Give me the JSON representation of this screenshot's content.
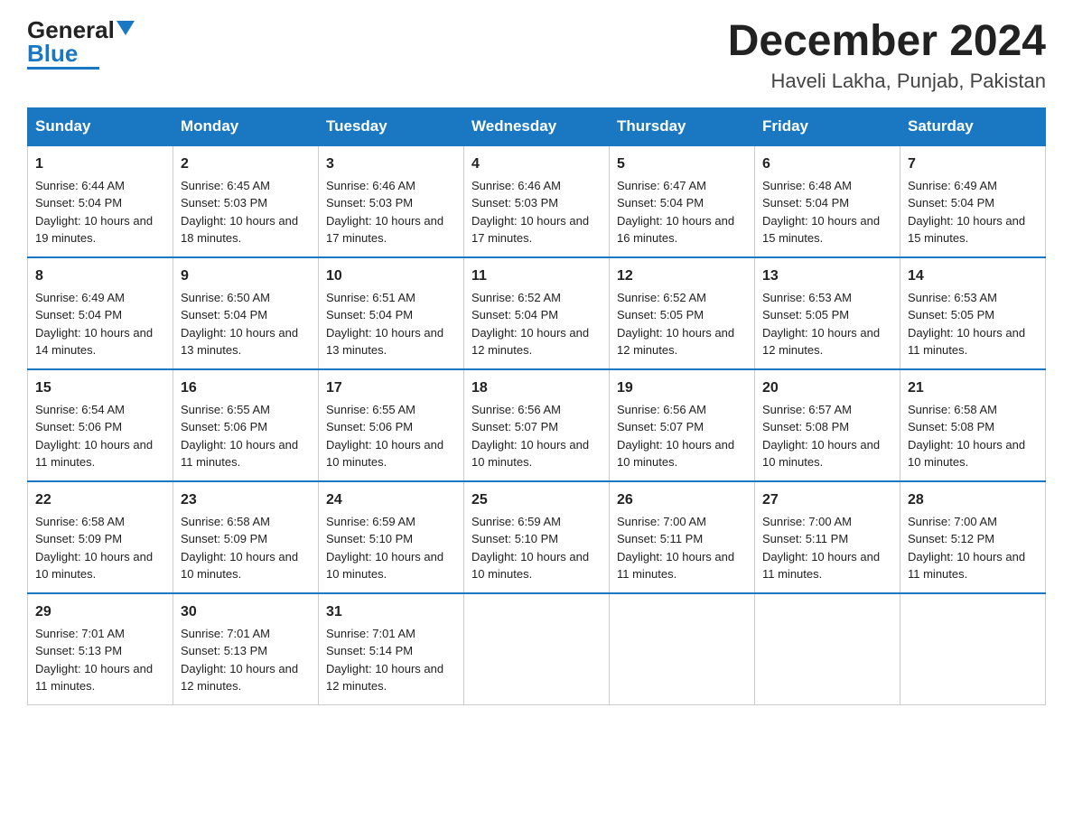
{
  "logo": {
    "general": "General",
    "blue": "Blue"
  },
  "title": "December 2024",
  "location": "Haveli Lakha, Punjab, Pakistan",
  "weekdays": [
    "Sunday",
    "Monday",
    "Tuesday",
    "Wednesday",
    "Thursday",
    "Friday",
    "Saturday"
  ],
  "weeks": [
    [
      {
        "day": "1",
        "sunrise": "6:44 AM",
        "sunset": "5:04 PM",
        "daylight": "10 hours and 19 minutes."
      },
      {
        "day": "2",
        "sunrise": "6:45 AM",
        "sunset": "5:03 PM",
        "daylight": "10 hours and 18 minutes."
      },
      {
        "day": "3",
        "sunrise": "6:46 AM",
        "sunset": "5:03 PM",
        "daylight": "10 hours and 17 minutes."
      },
      {
        "day": "4",
        "sunrise": "6:46 AM",
        "sunset": "5:03 PM",
        "daylight": "10 hours and 17 minutes."
      },
      {
        "day": "5",
        "sunrise": "6:47 AM",
        "sunset": "5:04 PM",
        "daylight": "10 hours and 16 minutes."
      },
      {
        "day": "6",
        "sunrise": "6:48 AM",
        "sunset": "5:04 PM",
        "daylight": "10 hours and 15 minutes."
      },
      {
        "day": "7",
        "sunrise": "6:49 AM",
        "sunset": "5:04 PM",
        "daylight": "10 hours and 15 minutes."
      }
    ],
    [
      {
        "day": "8",
        "sunrise": "6:49 AM",
        "sunset": "5:04 PM",
        "daylight": "10 hours and 14 minutes."
      },
      {
        "day": "9",
        "sunrise": "6:50 AM",
        "sunset": "5:04 PM",
        "daylight": "10 hours and 13 minutes."
      },
      {
        "day": "10",
        "sunrise": "6:51 AM",
        "sunset": "5:04 PM",
        "daylight": "10 hours and 13 minutes."
      },
      {
        "day": "11",
        "sunrise": "6:52 AM",
        "sunset": "5:04 PM",
        "daylight": "10 hours and 12 minutes."
      },
      {
        "day": "12",
        "sunrise": "6:52 AM",
        "sunset": "5:05 PM",
        "daylight": "10 hours and 12 minutes."
      },
      {
        "day": "13",
        "sunrise": "6:53 AM",
        "sunset": "5:05 PM",
        "daylight": "10 hours and 12 minutes."
      },
      {
        "day": "14",
        "sunrise": "6:53 AM",
        "sunset": "5:05 PM",
        "daylight": "10 hours and 11 minutes."
      }
    ],
    [
      {
        "day": "15",
        "sunrise": "6:54 AM",
        "sunset": "5:06 PM",
        "daylight": "10 hours and 11 minutes."
      },
      {
        "day": "16",
        "sunrise": "6:55 AM",
        "sunset": "5:06 PM",
        "daylight": "10 hours and 11 minutes."
      },
      {
        "day": "17",
        "sunrise": "6:55 AM",
        "sunset": "5:06 PM",
        "daylight": "10 hours and 10 minutes."
      },
      {
        "day": "18",
        "sunrise": "6:56 AM",
        "sunset": "5:07 PM",
        "daylight": "10 hours and 10 minutes."
      },
      {
        "day": "19",
        "sunrise": "6:56 AM",
        "sunset": "5:07 PM",
        "daylight": "10 hours and 10 minutes."
      },
      {
        "day": "20",
        "sunrise": "6:57 AM",
        "sunset": "5:08 PM",
        "daylight": "10 hours and 10 minutes."
      },
      {
        "day": "21",
        "sunrise": "6:58 AM",
        "sunset": "5:08 PM",
        "daylight": "10 hours and 10 minutes."
      }
    ],
    [
      {
        "day": "22",
        "sunrise": "6:58 AM",
        "sunset": "5:09 PM",
        "daylight": "10 hours and 10 minutes."
      },
      {
        "day": "23",
        "sunrise": "6:58 AM",
        "sunset": "5:09 PM",
        "daylight": "10 hours and 10 minutes."
      },
      {
        "day": "24",
        "sunrise": "6:59 AM",
        "sunset": "5:10 PM",
        "daylight": "10 hours and 10 minutes."
      },
      {
        "day": "25",
        "sunrise": "6:59 AM",
        "sunset": "5:10 PM",
        "daylight": "10 hours and 10 minutes."
      },
      {
        "day": "26",
        "sunrise": "7:00 AM",
        "sunset": "5:11 PM",
        "daylight": "10 hours and 11 minutes."
      },
      {
        "day": "27",
        "sunrise": "7:00 AM",
        "sunset": "5:11 PM",
        "daylight": "10 hours and 11 minutes."
      },
      {
        "day": "28",
        "sunrise": "7:00 AM",
        "sunset": "5:12 PM",
        "daylight": "10 hours and 11 minutes."
      }
    ],
    [
      {
        "day": "29",
        "sunrise": "7:01 AM",
        "sunset": "5:13 PM",
        "daylight": "10 hours and 11 minutes."
      },
      {
        "day": "30",
        "sunrise": "7:01 AM",
        "sunset": "5:13 PM",
        "daylight": "10 hours and 12 minutes."
      },
      {
        "day": "31",
        "sunrise": "7:01 AM",
        "sunset": "5:14 PM",
        "daylight": "10 hours and 12 minutes."
      },
      null,
      null,
      null,
      null
    ]
  ],
  "labels": {
    "sunrise": "Sunrise:",
    "sunset": "Sunset:",
    "daylight": "Daylight:"
  }
}
